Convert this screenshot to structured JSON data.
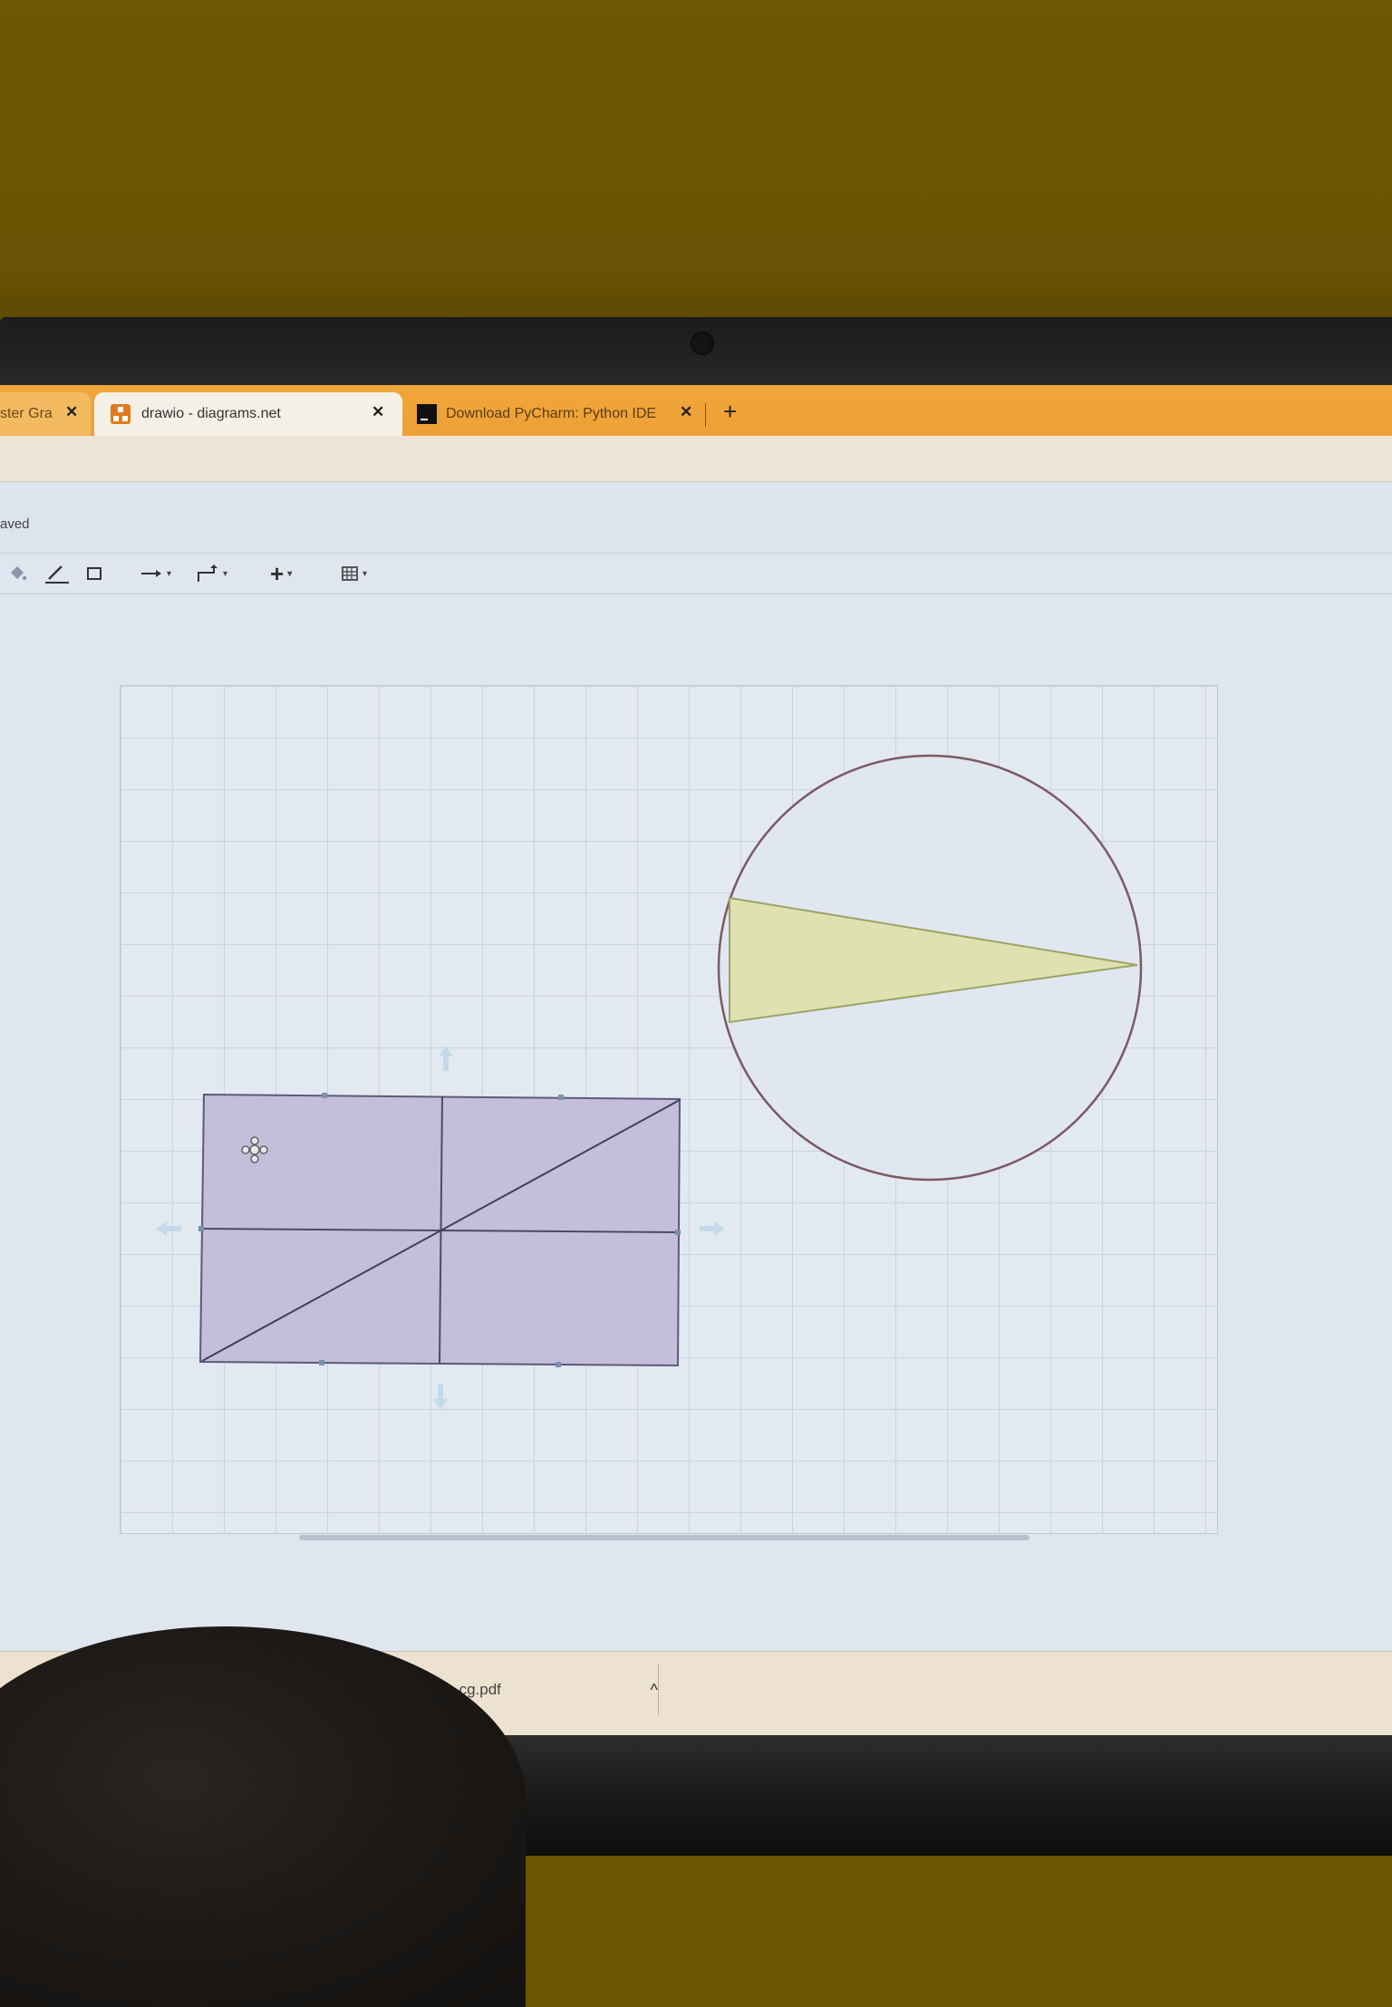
{
  "browser": {
    "tabs": [
      {
        "label": "ster Gra",
        "state": "partial"
      },
      {
        "label": "drawio - diagrams.net",
        "state": "active",
        "icon": "drawio-icon"
      },
      {
        "label": "Download PyCharm: Python IDE",
        "state": "inactive",
        "icon": "pycharm-icon"
      }
    ],
    "close_glyph": "✕",
    "new_tab_glyph": "+"
  },
  "app": {
    "status": "aved",
    "toolbar": {
      "fill_icon": "fill-color-icon",
      "line_icon": "line-color-icon",
      "shadow_icon": "shape-icon",
      "connection_icon": "connection-arrow-icon",
      "waypoint_icon": "waypoint-icon",
      "insert_glyph": "+",
      "table_icon": "table-icon",
      "caret": "▾"
    },
    "diagram": {
      "rectangle": {
        "fill": "#c5bedb",
        "stroke": "#5a5a7a"
      },
      "circle": {
        "fill": "#e1e7f0",
        "stroke": "#7a5a63"
      },
      "triangle": {
        "fill": "#dfe2b0",
        "stroke": "#9aa566"
      }
    }
  },
  "downloads": {
    "file_name": "week2_cg.pdf",
    "chevron": "^"
  }
}
